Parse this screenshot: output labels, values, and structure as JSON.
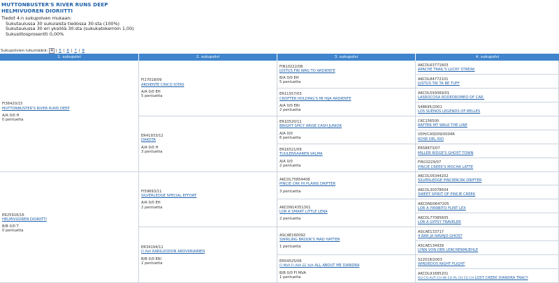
{
  "header": {
    "title1": "MUTTONBUSTER'S RIVER RUNS DEEP",
    "title2": "HELMIVUOREN DIORIITTI"
  },
  "info": {
    "heading": "Tiedot 4:n sukupolven mukaan:",
    "line1": "Sukutaulussa 30 sukulaista tiedossa 30:sta (100%)",
    "line2": "Sukutaulussa 30 eri yksilöä 30:sta (sukukatokerroin 1,00)",
    "line3": "Sukusiitosprosentti 0,00%"
  },
  "gen_nav": {
    "label": "Sukupolvien lukumäärä:",
    "options": [
      "4",
      "5",
      "6",
      "7",
      "8"
    ],
    "selected": "4"
  },
  "columns": [
    "1. sukupolvi",
    "2. sukupolvi",
    "3. sukupolvi",
    "4. sukupolvi"
  ],
  "gen1": [
    {
      "reg": "FI36420/15",
      "name": "MUTTONBUSTER'S RIVER RUNS DEEP",
      "codes": "A/A 0/0 H",
      "litters": "0 pentuetta"
    },
    {
      "reg": "ER25916/16",
      "name": "HELMIVUOREN DIORIITTI",
      "codes": "B/B 0/0 T",
      "litters": "0 pentuetta"
    }
  ],
  "gen2": [
    {
      "reg": "FI17018/09",
      "name": "ARDIENTE CINCO IOTAS",
      "codes": "A/A 0/0 EH",
      "litters": "5 pentuetta"
    },
    {
      "reg": "ER41933/12",
      "name": "DAKOTA",
      "codes": "A/A 0/0 H",
      "litters": "3 pentuetta"
    },
    {
      "reg": "FI59693/11",
      "name": "SILVERLEDGE SPECIAL EFFORT",
      "codes": "A/A 0/0 EH",
      "litters": "2 pentuetta"
    },
    {
      "reg": "ER34194/11",
      "prefix": "FI AVA",
      "name": "KARILUODON AROVIIRIAINEN",
      "codes": "B/B 0/0 ERI",
      "litters": "2 pentuetta"
    }
  ],
  "gen3": [
    {
      "reg": "FIN10222/08",
      "name": "JUSTUS FIN WAG TO ARDIENTE",
      "codes": "B/A 0/0 EH",
      "litters": "5 pentuetta"
    },
    {
      "reg": "ER11557/03",
      "name": "CROFTER HOLDING'S MI HIJA ARDIENTE",
      "codes": "A/A 0/0 ERI",
      "litters": "2 pentuetta"
    },
    {
      "reg": "ER10520/11",
      "name": "BRIGHT SPICY ARISE CASH JUNIOR",
      "codes": "A/A 0/0",
      "litters": "6 pentuetta"
    },
    {
      "reg": "ER16521/09",
      "name": "TUULENSAAREN VALMA",
      "codes": "A/A 0/0",
      "litters": "2 pentuetta"
    },
    {
      "reg": "AKCDL75854408",
      "name": "PINCIE CRK HI PLAINS DRIFTER",
      "codes": "",
      "litters": "3 pentuetta"
    },
    {
      "reg": "AKCDN14351301",
      "name": "LOR A SMART LITTLE LENA",
      "codes": "",
      "litters": "2 pentuetta"
    },
    {
      "reg": "ASCAE160092",
      "name": "SWIRLING BROOK'S MAD HATTER",
      "codes": "",
      "litters": "1 pentuetta"
    },
    {
      "reg": "ER54525/06",
      "prefix": "FI MVA FI AVA EE AVA",
      "name": "ALL ABOUT ME DIANDRA",
      "codes": "B/B 0/0 FI MVA",
      "litters": "1 pentuetta"
    }
  ],
  "gen4": [
    {
      "reg": "AKCDL63771603",
      "name": "APACHE TRAIL'S LUCKY STREAK"
    },
    {
      "reg": "AKCDL84772101",
      "name": "JUSTUS TRI TA BE TUFF"
    },
    {
      "reg": "AKCDL593069/01",
      "name": "LASROCOSA RODEOROMEO OF CAR."
    },
    {
      "reg": "S48695/2001",
      "name": "LOS SUEÑOS LEGENDS OF BELLES"
    },
    {
      "reg": "CKC156500",
      "name": "RAFTER MT WALK THE LINE"
    },
    {
      "reg": "VDH/CASD09/0004R",
      "name": "ROSE DEL RIO"
    },
    {
      "reg": "ER58873/07",
      "name": "MILLER RIDGE'S GHOST TOWN"
    },
    {
      "reg": "FIN10229/07",
      "name": "PINCIE CREEK'S MOCHA LATTE"
    },
    {
      "reg": "AKCDL56344202",
      "name": "SILVERLEDGE PINCIERCRK DRIFTER"
    },
    {
      "reg": "AKCDL30378504",
      "name": "SWEET SPIRIT OF PINCIE CREEK"
    },
    {
      "reg": "AKCDN00647205",
      "name": "LOR A IYANBITO FLINT LEX"
    },
    {
      "reg": "AKCDL77085605",
      "name": "LOR A GYPSY TRAVELER"
    },
    {
      "reg": "ASCAE133717",
      "name": "4 BAR JA NAVAJO GHOST"
    },
    {
      "reg": "ASCAE134939",
      "name": "LYNN VON DER LERCHENMUEHLE"
    },
    {
      "reg": "S22018/2003",
      "name": "WINDEDOS NIGHT FLIGHT"
    },
    {
      "reg": "AKCDL91685201",
      "prefix": "HU CH AUT CH SK CH PL CH CS CH",
      "name": "LOST CREEK DIANDRA TRACY"
    }
  ]
}
